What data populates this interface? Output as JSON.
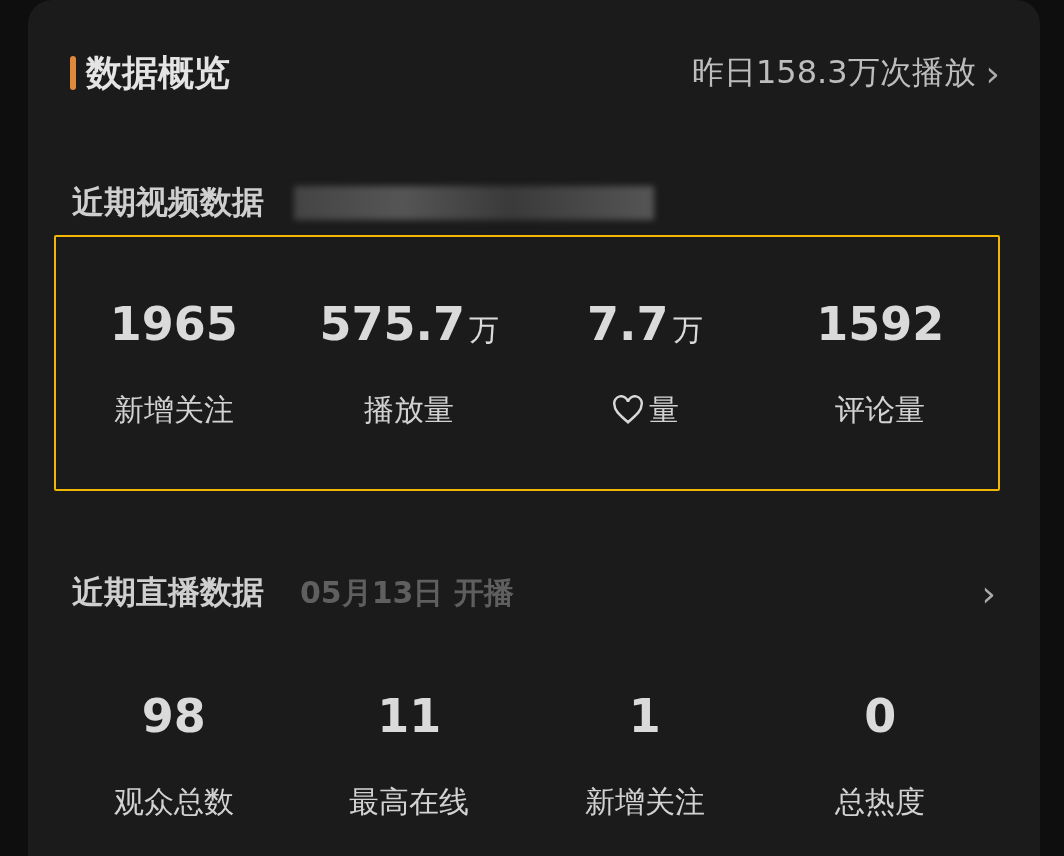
{
  "overview": {
    "title": "数据概览",
    "summary": "昨日158.3万次播放",
    "chevron": "›"
  },
  "video": {
    "title": "近期视频数据",
    "highlighted": true,
    "stats": [
      {
        "kind": "plain",
        "value": "1965",
        "label": "新增关注"
      },
      {
        "kind": "plain",
        "value": "575.7",
        "unit": "万",
        "label": "播放量"
      },
      {
        "kind": "like",
        "value": "7.7",
        "unit": "万",
        "label": "量"
      },
      {
        "kind": "plain",
        "value": "1592",
        "label": "评论量"
      }
    ]
  },
  "live": {
    "title": "近期直播数据",
    "date": "05月13日 开播",
    "chevron": "›",
    "stats": [
      {
        "value": "98",
        "label": "观众总数"
      },
      {
        "value": "11",
        "label": "最高在线"
      },
      {
        "value": "1",
        "label": "新增关注"
      },
      {
        "value": "0",
        "label": "总热度"
      }
    ]
  }
}
